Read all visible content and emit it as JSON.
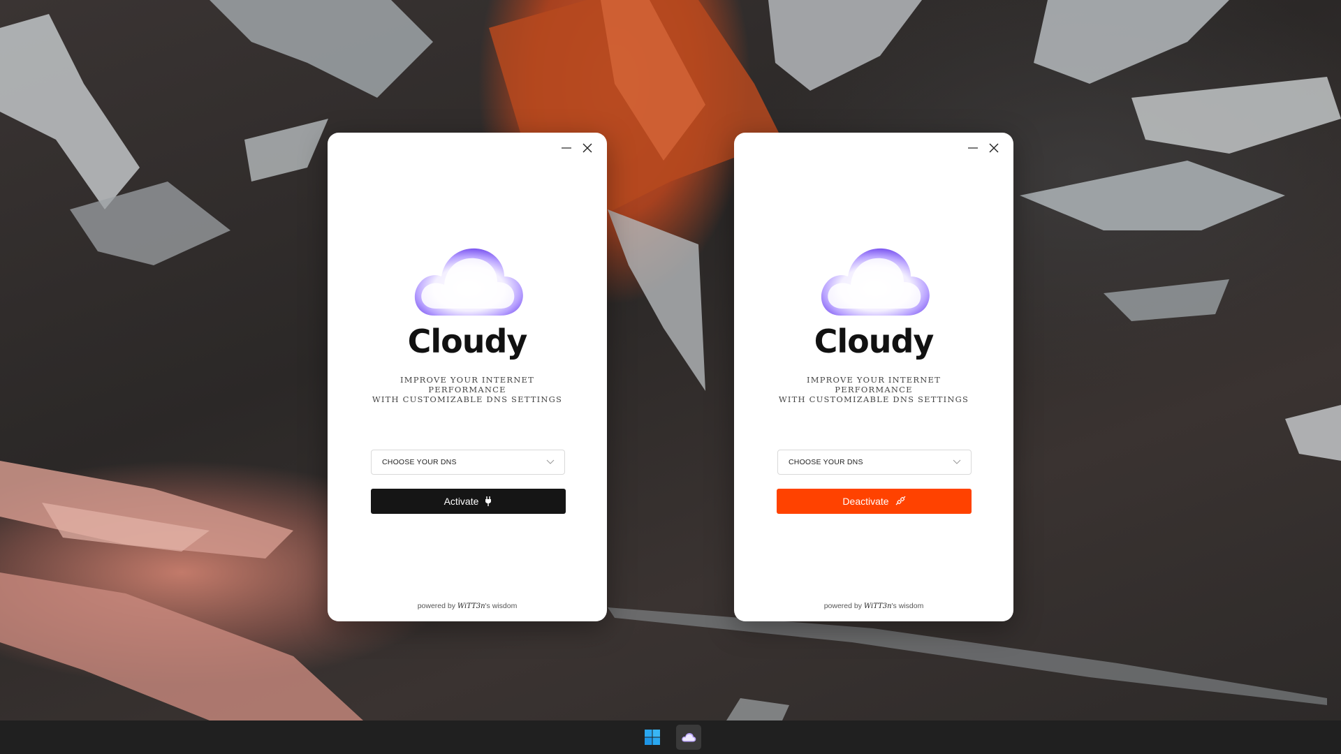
{
  "apps": [
    {
      "brand": "Cloudy",
      "tagline": [
        "IMPROVE YOUR INTERNET PERFORMANCE",
        "WITH CUSTOMIZABLE DNS SETTINGS"
      ],
      "dns_select": {
        "placeholder": "CHOOSE YOUR DNS"
      },
      "action_button": {
        "label": "Activate",
        "icon": "plug-icon",
        "color": "#151515"
      },
      "footer": {
        "prefix": "powered by",
        "signature": "WiTT3n",
        "suffix": "'s wisdom"
      }
    },
    {
      "brand": "Cloudy",
      "tagline": [
        "IMPROVE YOUR INTERNET PERFORMANCE",
        "WITH CUSTOMIZABLE DNS SETTINGS"
      ],
      "dns_select": {
        "placeholder": "CHOOSE YOUR DNS"
      },
      "action_button": {
        "label": "Deactivate",
        "icon": "unplug-icon",
        "color": "#ff4200"
      },
      "footer": {
        "prefix": "powered by",
        "signature": "WiTT3n",
        "suffix": "'s wisdom"
      }
    }
  ],
  "colors": {
    "accent_purple": "#8a6cf0",
    "deactivate_orange": "#ff4200",
    "activate_black": "#151515",
    "taskbar": "#202020"
  },
  "taskbar": {
    "items": [
      {
        "icon": "windows-start-icon",
        "active": false
      },
      {
        "icon": "cloudy-app-icon",
        "active": true
      }
    ]
  }
}
